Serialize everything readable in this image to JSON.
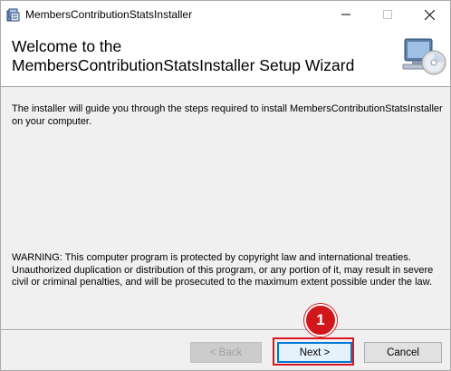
{
  "window": {
    "title": "MembersContributionStatsInstaller",
    "controls": {
      "minimize": "—",
      "maximize": "☐",
      "close": "✕"
    }
  },
  "header": {
    "title_line1": "Welcome to the",
    "title_line2": "MembersContributionStatsInstaller Setup Wizard",
    "icon": "computer-cd-icon"
  },
  "body": {
    "intro": "The installer will guide you through the steps required to install MembersContributionStatsInstaller on your computer.",
    "warning": "WARNING: This computer program is protected by copyright law and international treaties. Unauthorized duplication or distribution of this program, or any portion of it, may result in severe civil or criminal penalties, and will be prosecuted to the maximum extent possible under the law."
  },
  "buttons": {
    "back": "< Back",
    "next": "Next >",
    "cancel": "Cancel"
  },
  "annotation": {
    "step_number": "1",
    "color": "#d2171c"
  }
}
